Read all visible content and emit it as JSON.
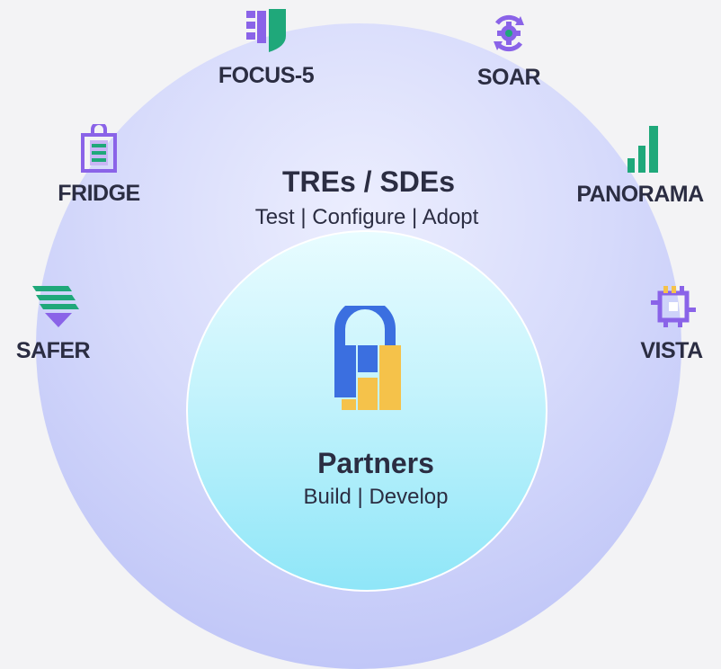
{
  "outer": {
    "title": "TREs / SDEs",
    "subtitle": "Test | Configure | Adopt"
  },
  "inner": {
    "title": "Partners",
    "subtitle": "Build | Develop"
  },
  "nodes": {
    "focus5": {
      "label": "FOCUS-5",
      "icon": "shield-column-icon",
      "color": "#1fa87a"
    },
    "soar": {
      "label": "SOAR",
      "icon": "gear-cycle-icon",
      "color": "#8a63e8"
    },
    "fridge": {
      "label": "FRIDGE",
      "icon": "clipboard-icon",
      "color": "#8a63e8"
    },
    "panorama": {
      "label": "PANORAMA",
      "icon": "bar-chart-icon",
      "color": "#1fa87a"
    },
    "safer": {
      "label": "SAFER",
      "icon": "layers-arrow-icon",
      "color": "#1fa87a"
    },
    "vista": {
      "label": "VISTA",
      "icon": "chip-icon",
      "color": "#8a63e8"
    }
  },
  "center_icon": {
    "icon": "padlock-blocks-icon",
    "colors": [
      "#3b6fe0",
      "#f5c24a"
    ]
  }
}
